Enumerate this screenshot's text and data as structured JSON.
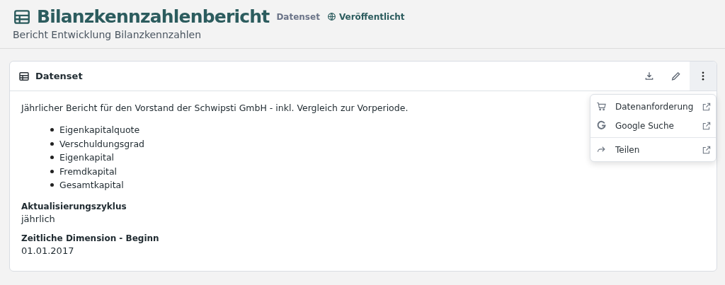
{
  "header": {
    "title": "Bilanzkennzahlenbericht",
    "type_label": "Datenset",
    "status": "Veröffentlicht",
    "subtitle": "Bericht Entwicklung Bilanzkennzahlen"
  },
  "card": {
    "title": "Datenset",
    "actions": [
      {
        "kind": "download",
        "selected": false
      },
      {
        "kind": "edit",
        "selected": false
      },
      {
        "kind": "more",
        "selected": true
      }
    ],
    "description": "Jährlicher Bericht für den Vorstand der Schwipsti GmbH - inkl. Vergleich zur Vorperiode.",
    "bullets": [
      "Eigenkapitalquote",
      "Verschuldungsgrad",
      "Eigenkapital",
      "Fremdkapital",
      "Gesamtkapital"
    ],
    "fields": [
      {
        "label": "Aktualisierungszyklus",
        "value": "jährlich"
      },
      {
        "label": "Zeitliche Dimension - Beginn",
        "value": "01.01.2017"
      }
    ]
  },
  "menu": {
    "items": [
      {
        "kind": "cart",
        "label": "Datenanforderung",
        "divider_before": false
      },
      {
        "kind": "google",
        "label": "Google Suche",
        "divider_before": false
      },
      {
        "kind": "share",
        "label": "Teilen",
        "divider_before": true
      }
    ]
  }
}
